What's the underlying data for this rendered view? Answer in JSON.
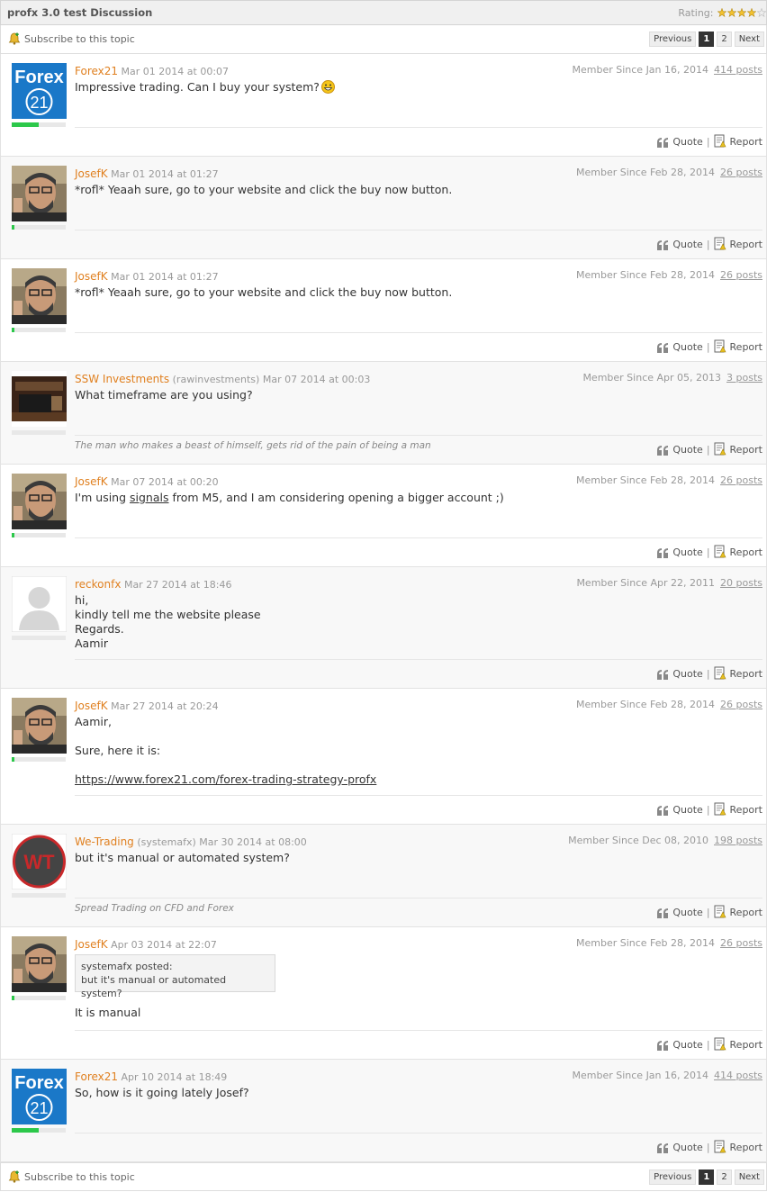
{
  "header": {
    "title": "profx 3.0 test Discussion",
    "rating_label": "Rating:",
    "rating_stars": 4,
    "rating_max": 5
  },
  "toolbar": {
    "subscribe_label": "Subscribe to this topic",
    "previous_label": "Previous",
    "pages": [
      "1",
      "2"
    ],
    "current_page": "1",
    "next_label": "Next"
  },
  "actions": {
    "quote_label": "Quote",
    "separator": "|",
    "report_label": "Report"
  },
  "posts": [
    {
      "author": "Forex21",
      "handle": "",
      "date": "Mar 01 2014 at 00:07",
      "member_since": "Member Since Jan 16, 2014",
      "posts": "414 posts",
      "avatar": "forex21-logo",
      "rank_fraction": 0.5,
      "lines": [
        "Impressive trading. Can I buy your system?"
      ],
      "signature": ""
    },
    {
      "author": "JosefK",
      "handle": "",
      "date": "Mar 01 2014 at 01:27",
      "member_since": "Member Since Feb 28, 2014",
      "posts": "26 posts",
      "avatar": "man-photo",
      "rank_fraction": 0.05,
      "lines": [
        "*rofl* Yeaah sure, go to your website and click the buy now button."
      ],
      "signature": ""
    },
    {
      "author": "JosefK",
      "handle": "",
      "date": "Mar 01 2014 at 01:27",
      "member_since": "Member Since Feb 28, 2014",
      "posts": "26 posts",
      "avatar": "man-photo",
      "rank_fraction": 0.05,
      "lines": [
        "*rofl* Yeaah sure, go to your website and click the buy now button."
      ],
      "signature": ""
    },
    {
      "author": "SSW Investments",
      "handle": "(rawinvestments)",
      "date": "Mar 07 2014 at 00:03",
      "member_since": "Member Since Apr 05, 2013",
      "posts": "3 posts",
      "avatar": "desk-photo",
      "rank_fraction": 0,
      "lines": [
        "What timeframe are you using?"
      ],
      "signature": "The man who makes a beast of himself, gets rid of the pain of being a man"
    },
    {
      "author": "JosefK",
      "handle": "",
      "date": "Mar 07 2014 at 00:20",
      "member_since": "Member Since Feb 28, 2014",
      "posts": "26 posts",
      "avatar": "man-photo",
      "rank_fraction": 0.05,
      "line_before": "I'm using ",
      "line_link": "signals",
      "line_after": " from M5, and I am considering opening a bigger account ;)",
      "signature": ""
    },
    {
      "author": "reckonfx",
      "handle": "",
      "date": "Mar 27 2014 at 18:46",
      "member_since": "Member Since Apr 22, 2011",
      "posts": "20 posts",
      "avatar": "default-silhouette",
      "rank_fraction": 0,
      "lines": [
        "hi,",
        "kindly tell me the website please",
        "Regards.",
        "Aamir"
      ],
      "signature": ""
    },
    {
      "author": "JosefK",
      "handle": "",
      "date": "Mar 27 2014 at 20:24",
      "member_since": "Member Since Feb 28, 2014",
      "posts": "26 posts",
      "avatar": "man-photo",
      "rank_fraction": 0.05,
      "lines": [
        "Aamir,",
        "",
        "Sure, here it is:",
        ""
      ],
      "link": "https://www.forex21.com/forex-trading-strategy-profx",
      "signature": ""
    },
    {
      "author": "We-Trading",
      "handle": "(systemafx)",
      "date": "Mar 30 2014 at 08:00",
      "member_since": "Member Since Dec 08, 2010",
      "posts": "198 posts",
      "avatar": "wt-logo",
      "rank_fraction": 0,
      "lines": [
        "but it's manual or automated system?"
      ],
      "signature": "Spread Trading on CFD and Forex",
      "avatar_text": "WT"
    },
    {
      "author": "JosefK",
      "handle": "",
      "date": "Apr 03 2014 at 22:07",
      "member_since": "Member Since Feb 28, 2014",
      "posts": "26 posts",
      "avatar": "man-photo",
      "rank_fraction": 0.05,
      "quote_author": "systemafx posted:",
      "quote_text": "but it's manual or automated system?",
      "lines": [
        "It is manual"
      ],
      "signature": ""
    },
    {
      "author": "Forex21",
      "handle": "",
      "date": "Apr 10 2014 at 18:49",
      "member_since": "Member Since Jan 16, 2014",
      "posts": "414 posts",
      "avatar": "forex21-logo",
      "rank_fraction": 0.5,
      "lines": [
        "So, how is it going lately Josef?"
      ],
      "signature": ""
    }
  ],
  "logo_text": {
    "forex": "Forex",
    "num": "21"
  },
  "colors": {
    "author": "#e08020",
    "rank_fill": "#2cc84a",
    "forex_blue": "#1a78c8",
    "wt_red": "#c8282a"
  }
}
